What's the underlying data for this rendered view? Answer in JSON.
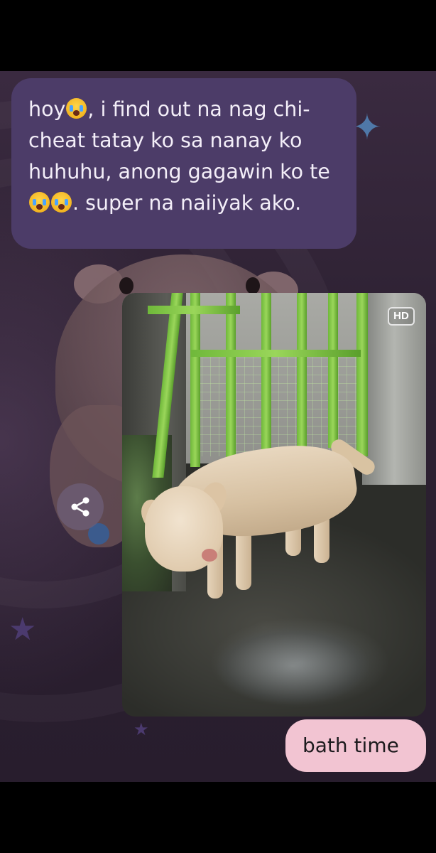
{
  "chat": {
    "incoming_message": {
      "segments": [
        "hoy",
        ", i find out na nag chi-cheat tatay ko sa nanay ko huhuhu, anong gagawin ko te",
        ". super na naiiyak ako."
      ],
      "emoji": "loudly-crying-face"
    },
    "image_message": {
      "badge": "HD",
      "subject": "dog-photo"
    },
    "share_button": {
      "icon": "share-icon"
    },
    "outgoing_message": {
      "text": "bath time"
    }
  },
  "colors": {
    "incoming_bubble": "#4c3c68",
    "outgoing_bubble": "#f2c4d2",
    "background": "#2d2132"
  }
}
